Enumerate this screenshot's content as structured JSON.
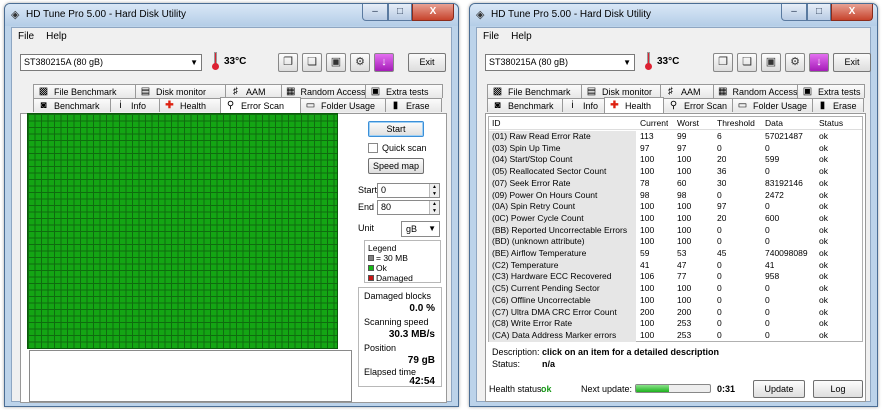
{
  "app": {
    "title": "HD Tune Pro 5.00 - Hard Disk Utility",
    "menu": [
      "File",
      "Help"
    ],
    "drive": "ST380215A (80 gB)",
    "temperature": "33",
    "temperature_unit": "°C",
    "exit_label": "Exit",
    "window_buttons": {
      "minimize": "–",
      "maximize": "□",
      "close": "X"
    }
  },
  "tabs_row1": [
    {
      "label": "File Benchmark",
      "icon": "file-benchmark-icon"
    },
    {
      "label": "Disk monitor",
      "icon": "disk-monitor-icon"
    },
    {
      "label": "AAM",
      "icon": "speaker-icon"
    },
    {
      "label": "Random Access",
      "icon": "random-access-icon"
    },
    {
      "label": "Extra tests",
      "icon": "extra-tests-icon"
    }
  ],
  "tabs_row2": [
    {
      "label": "Benchmark",
      "icon": "benchmark-icon"
    },
    {
      "label": "Info",
      "icon": "info-icon"
    },
    {
      "label": "Health",
      "icon": "health-cross-icon"
    },
    {
      "label": "Error Scan",
      "icon": "magnifier-icon"
    },
    {
      "label": "Folder Usage",
      "icon": "folder-icon"
    },
    {
      "label": "Erase",
      "icon": "erase-icon"
    }
  ],
  "error_scan": {
    "active_tab": "Error Scan",
    "start_button": "Start",
    "quick_scan_label": "Quick scan",
    "quick_scan_checked": false,
    "speed_map_button": "Speed map",
    "start_label": "Start",
    "start_value": "0",
    "end_label": "End",
    "end_value": "80",
    "unit_label": "Unit",
    "unit_value": "gB",
    "legend": {
      "title": "Legend",
      "items": [
        {
          "label": "= 30 MB",
          "color": "#808080"
        },
        {
          "label": "Ok",
          "color": "#14b814"
        },
        {
          "label": "Damaged",
          "color": "#c81414"
        }
      ]
    },
    "stats": {
      "damaged_label": "Damaged blocks",
      "damaged_value": "0.0 %",
      "speed_label": "Scanning speed",
      "speed_value": "30.3 MB/s",
      "position_label": "Position",
      "position_value": "79 gB",
      "elapsed_label": "Elapsed time",
      "elapsed_value": "42:54"
    },
    "grid_color": "#14a514"
  },
  "health": {
    "active_tab": "Health",
    "columns": [
      "ID",
      "Current",
      "Worst",
      "Threshold",
      "Data",
      "Status"
    ],
    "rows": [
      [
        "(01) Raw Read Error Rate",
        "113",
        "99",
        "6",
        "57021487",
        "ok"
      ],
      [
        "(03) Spin Up Time",
        "97",
        "97",
        "0",
        "0",
        "ok"
      ],
      [
        "(04) Start/Stop Count",
        "100",
        "100",
        "20",
        "599",
        "ok"
      ],
      [
        "(05) Reallocated Sector Count",
        "100",
        "100",
        "36",
        "0",
        "ok"
      ],
      [
        "(07) Seek Error Rate",
        "78",
        "60",
        "30",
        "83192146",
        "ok"
      ],
      [
        "(09) Power On Hours Count",
        "98",
        "98",
        "0",
        "2472",
        "ok"
      ],
      [
        "(0A) Spin Retry Count",
        "100",
        "100",
        "97",
        "0",
        "ok"
      ],
      [
        "(0C) Power Cycle Count",
        "100",
        "100",
        "20",
        "600",
        "ok"
      ],
      [
        "(BB) Reported Uncorrectable Errors",
        "100",
        "100",
        "0",
        "0",
        "ok"
      ],
      [
        "(BD) (unknown attribute)",
        "100",
        "100",
        "0",
        "0",
        "ok"
      ],
      [
        "(BE) Airflow Temperature",
        "59",
        "53",
        "45",
        "740098089",
        "ok"
      ],
      [
        "(C2) Temperature",
        "41",
        "47",
        "0",
        "41",
        "ok"
      ],
      [
        "(C3) Hardware ECC Recovered",
        "106",
        "77",
        "0",
        "958",
        "ok"
      ],
      [
        "(C5) Current Pending Sector",
        "100",
        "100",
        "0",
        "0",
        "ok"
      ],
      [
        "(C6) Offline Uncorrectable",
        "100",
        "100",
        "0",
        "0",
        "ok"
      ],
      [
        "(C7) Ultra DMA CRC Error Count",
        "200",
        "200",
        "0",
        "0",
        "ok"
      ],
      [
        "(C8) Write Error Rate",
        "100",
        "253",
        "0",
        "0",
        "ok"
      ],
      [
        "(CA) Data Address Marker errors",
        "100",
        "253",
        "0",
        "0",
        "ok"
      ]
    ],
    "description_label": "Description:",
    "description_value": "click on an item for a detailed description",
    "status_label": "Status:",
    "status_value": "n/a",
    "health_status_label": "Health status:",
    "health_status_value": "ok",
    "health_status_color": "#1a9a1a",
    "next_update_label": "Next update:",
    "next_update_value": "0:31",
    "next_update_progress": 0.45,
    "update_button": "Update",
    "log_button": "Log"
  }
}
